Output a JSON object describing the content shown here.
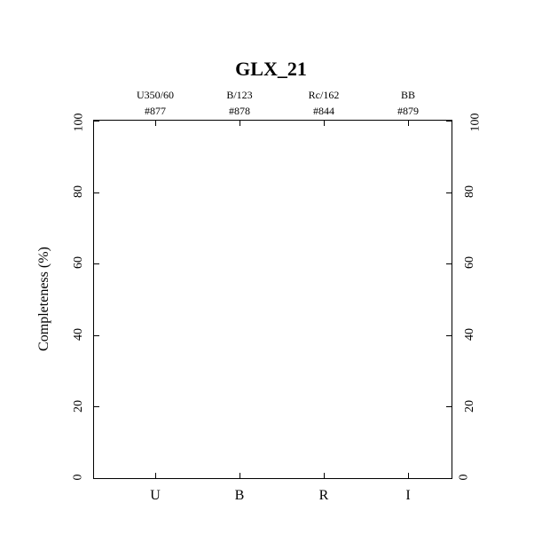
{
  "chart_data": {
    "type": "bar",
    "title": "GLX_21",
    "ylabel": "Completeness (%)",
    "xlabel": "",
    "ylim": [
      0,
      100
    ],
    "yticks": [
      0,
      20,
      40,
      60,
      80,
      100
    ],
    "categories": [
      "U",
      "B",
      "R",
      "I"
    ],
    "top_labels_row1": [
      "U350/60",
      "B/123",
      "Rc/162",
      "BB"
    ],
    "top_labels_row2": [
      "#877",
      "#878",
      "#844",
      "#879"
    ],
    "values": [
      0,
      0,
      0,
      0
    ]
  }
}
